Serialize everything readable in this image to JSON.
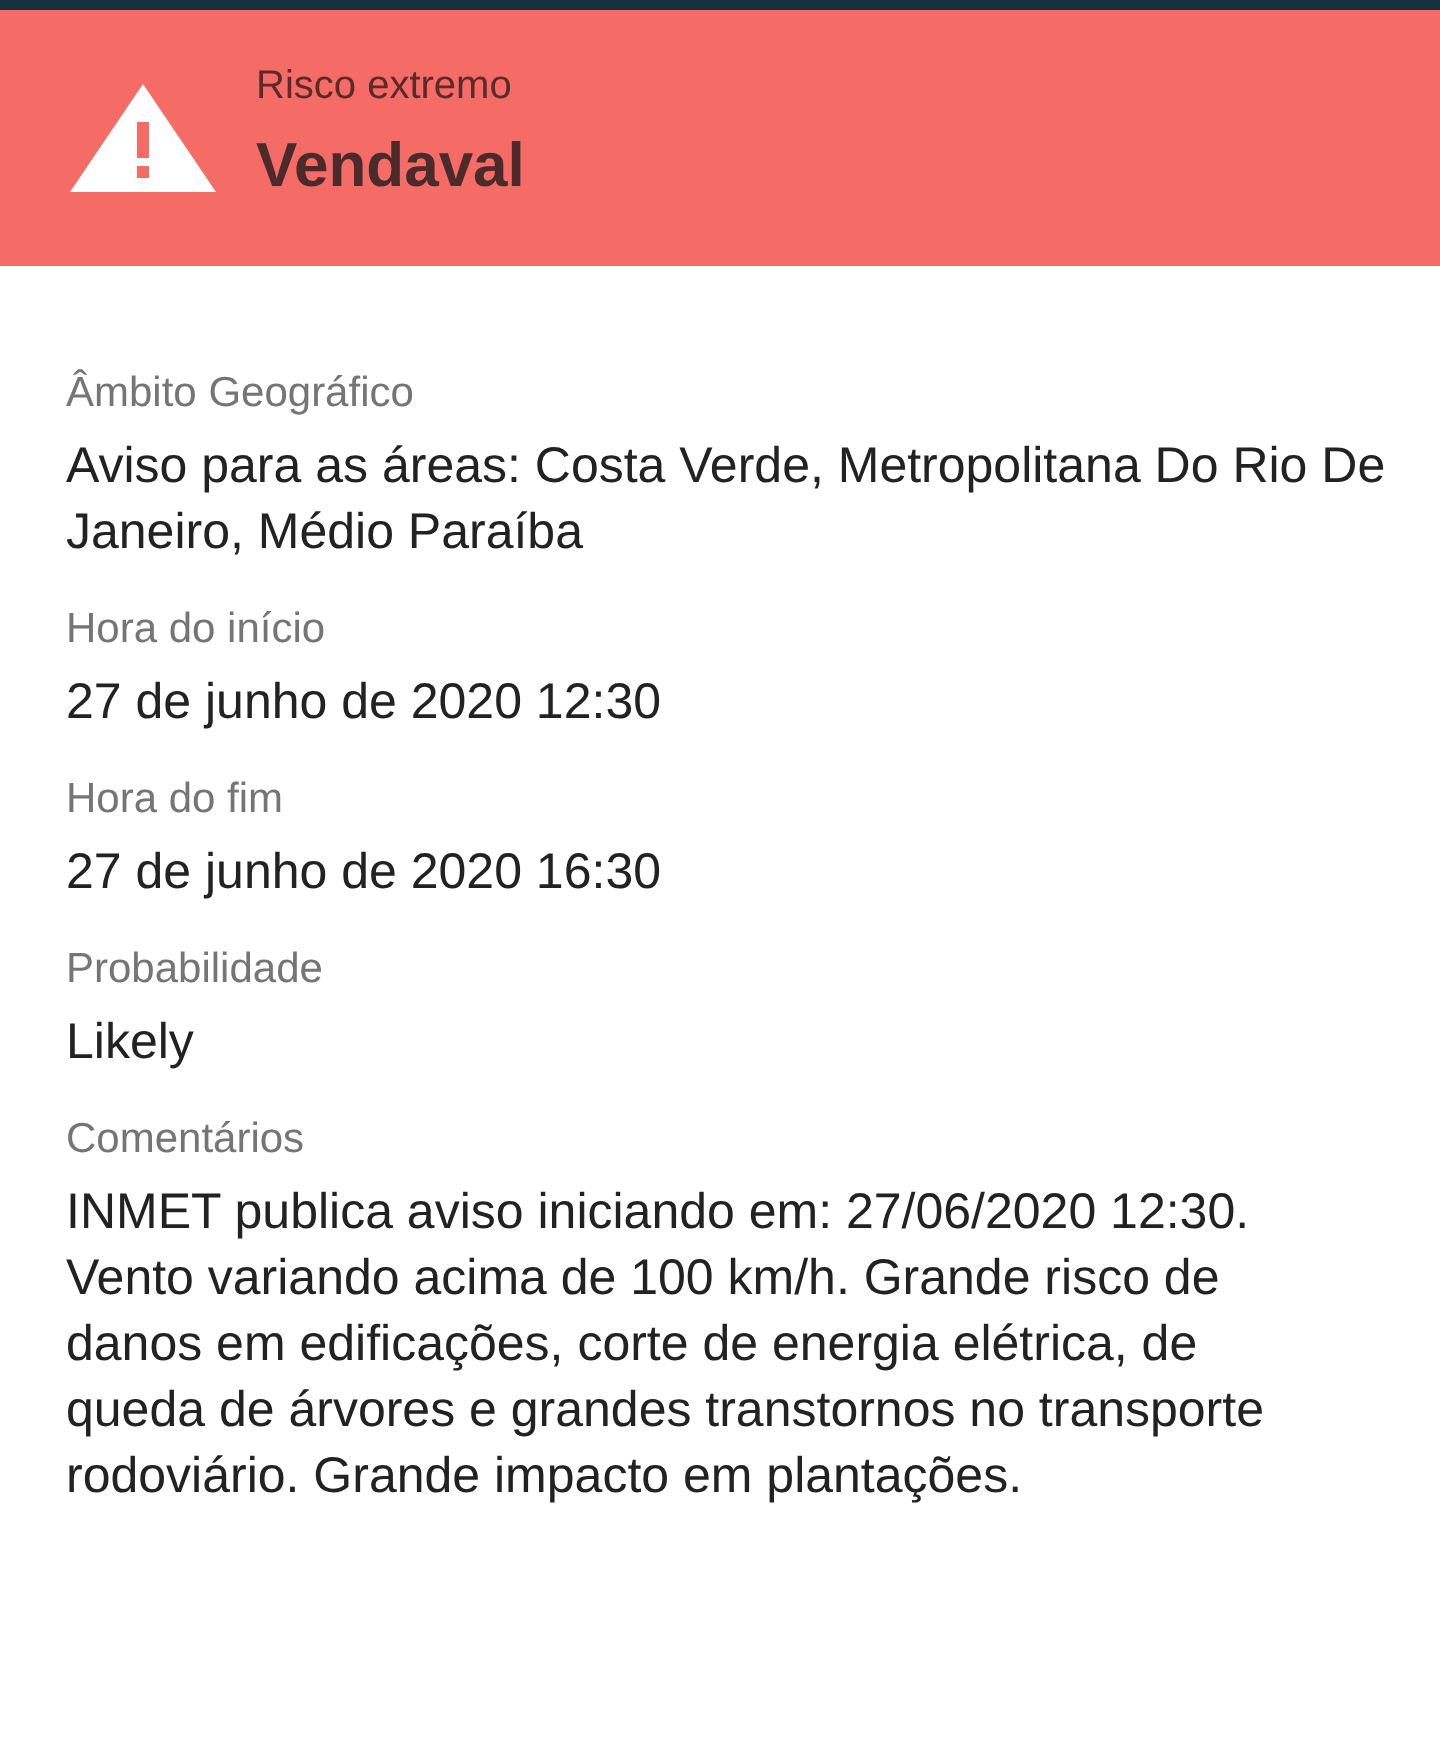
{
  "alert": {
    "severity": "Risco extremo",
    "title": "Vendaval"
  },
  "fields": [
    {
      "label": "Âmbito Geográfico",
      "value": "Aviso para as áreas: Costa Verde, Metropolitana Do Rio De Janeiro, Médio Paraíba"
    },
    {
      "label": "Hora do início",
      "value": "27 de junho de 2020 12:30"
    },
    {
      "label": "Hora do fim",
      "value": "27 de junho de 2020 16:30"
    },
    {
      "label": "Probabilidade",
      "value": "Likely"
    },
    {
      "label": "Comentários",
      "value": "INMET publica aviso iniciando em: 27/06/2020 12:30. Vento variando acima de 100 km/h. Grande risco de danos em edificações, corte de energia elétrica, de queda de árvores e grandes transtornos no transporte rodoviário. Grande impacto em plantações."
    }
  ]
}
